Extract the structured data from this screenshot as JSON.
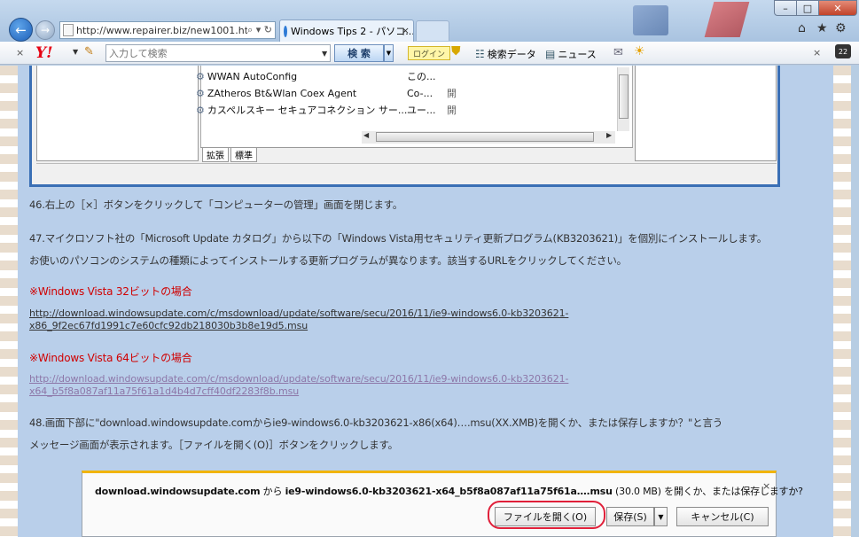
{
  "browser": {
    "url": "http://www.repairer.biz/new1001.ht",
    "tab_title": "Windows Tips 2 - パソコ...",
    "tab_close": "×"
  },
  "toolbar": {
    "close": "×",
    "logo": "Y!",
    "search_placeholder": "入力して検索",
    "search_button": "検 索",
    "login": "ログイン",
    "search_data": "検索データ",
    "news": "ニュース",
    "close_right": "×",
    "badge": "22"
  },
  "embedded": {
    "services": [
      {
        "name": "WWAN AutoConfig",
        "desc": "この...",
        "status": ""
      },
      {
        "name": "ZAtheros Bt&Wlan Coex Agent",
        "desc": "Co-...",
        "status": "開"
      },
      {
        "name": "カスペルスキー セキュアコネクション サー...",
        "desc": "ユー...",
        "status": "開"
      }
    ],
    "tabs": [
      "拡張",
      "標準"
    ]
  },
  "article": {
    "step46": "46.右上の［×］ボタンをクリックして「コンピューターの管理」画面を閉じます。",
    "step47_line1": "47.マイクロソフト社の「Microsoft Update カタログ」から以下の「Windows Vista用セキュリティ更新プログラム(KB3203621)」を個別にインストールします。",
    "step47_line2": "お使いのパソコンのシステムの種類によってインストールする更新プログラムが異なります。該当するURLをクリックしてください。",
    "heading32": "※Windows Vista 32ビットの場合",
    "link32_line1": "http://download.windowsupdate.com/c/msdownload/update/software/secu/2016/11/ie9-windows6.0-kb3203621-",
    "link32_line2": "x86_9f2ec67fd1991c7e60cfc92db218030b3b8e19d5.msu",
    "heading64": "※Windows Vista 64ビットの場合",
    "link64_line1": "http://download.windowsupdate.com/c/msdownload/update/software/secu/2016/11/ie9-windows6.0-kb3203621-",
    "link64_line2": "x64_b5f8a087af11a75f61a1d4b4d7cff40df2283f8b.msu",
    "step48_line1": "48.画面下部に\"download.windowsupdate.comからie9-windows6.0-kb3203621-x86(x64)….msu(XX.XMB)を開くか、または保存しますか？\"と言う",
    "step48_line2": "メッセージ画面が表示されます。［ファイルを開く(O)］ボタンをクリックします。"
  },
  "download_bar": {
    "site": "download.windowsupdate.com",
    "from": " から ",
    "filename": "ie9-windows6.0-kb3203621-x64_b5f8a087af11a75f61a….msu",
    "size": " (30.0 MB) ",
    "question": "を開くか、または保存しますか?",
    "close": "×",
    "open_button": "ファイルを開く(O)",
    "save_button": "保存(S)",
    "cancel_button": "キャンセル(C)"
  },
  "colors": {
    "accent": "#1d5fb8",
    "red_heading": "#d00000",
    "highlight": "#e0203a",
    "notification_accent": "#f1b400"
  }
}
